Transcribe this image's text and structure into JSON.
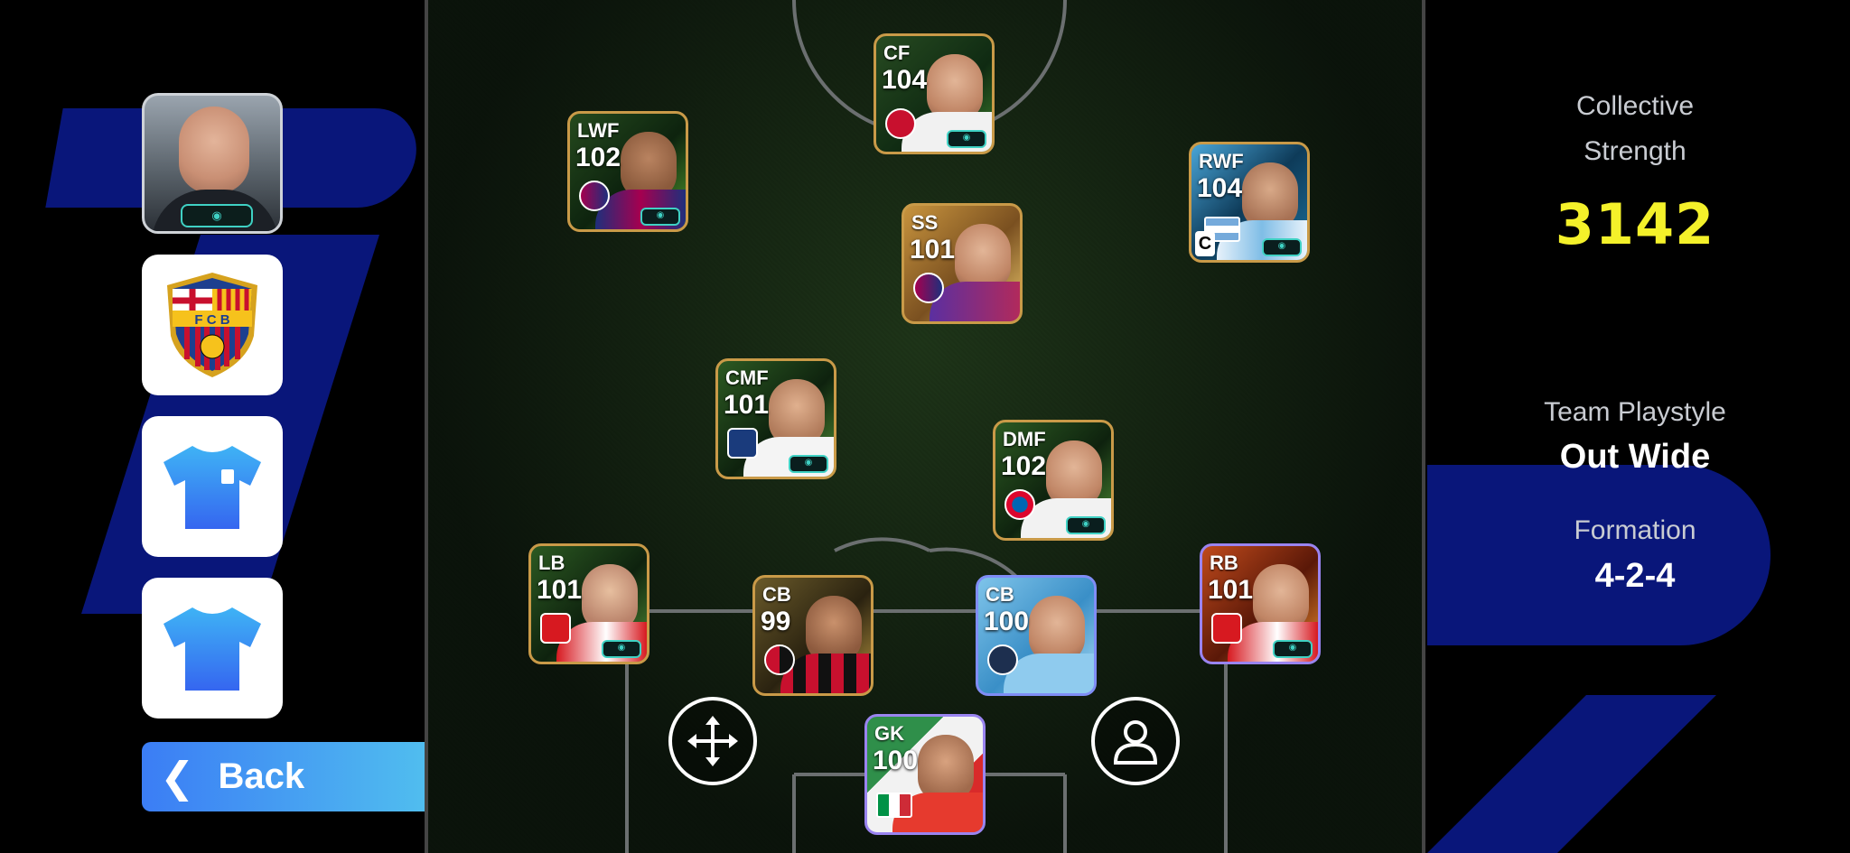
{
  "left_panel": {
    "back_label": "Back"
  },
  "stats": {
    "collective_strength_label_1": "Collective",
    "collective_strength_label_2": "Strength",
    "collective_strength_value": "3142",
    "team_playstyle_label": "Team Playstyle",
    "team_playstyle_value": "Out Wide",
    "formation_label": "Formation",
    "formation_value": "4-2-4"
  },
  "colors": {
    "strength_yellow": "#f4f12a",
    "back_gradient_start": "#3b7df5",
    "back_gradient_end": "#53c6ee",
    "kit_blue": "#3d8ff0",
    "ebadge_teal": "#3fd1c4"
  },
  "players": [
    {
      "id": "cf",
      "position": "CF",
      "rating": "104"
    },
    {
      "id": "lwf",
      "position": "LWF",
      "rating": "102"
    },
    {
      "id": "rwf",
      "position": "RWF",
      "rating": "104",
      "captain": "C"
    },
    {
      "id": "ss",
      "position": "SS",
      "rating": "101"
    },
    {
      "id": "cmf",
      "position": "CMF",
      "rating": "101"
    },
    {
      "id": "dmf",
      "position": "DMF",
      "rating": "102"
    },
    {
      "id": "lb",
      "position": "LB",
      "rating": "101"
    },
    {
      "id": "cb1",
      "position": "CB",
      "rating": "99"
    },
    {
      "id": "cb2",
      "position": "CB",
      "rating": "100"
    },
    {
      "id": "rb",
      "position": "RB",
      "rating": "101"
    },
    {
      "id": "gk",
      "position": "GK",
      "rating": "100"
    }
  ],
  "icons": {
    "move": "move-arrows-icon",
    "player": "person-icon",
    "back": "chevron-left-icon",
    "club_crest": "fcb-crest-icon",
    "kit_home": "home-kit-icon",
    "kit_away": "away-kit-icon"
  }
}
